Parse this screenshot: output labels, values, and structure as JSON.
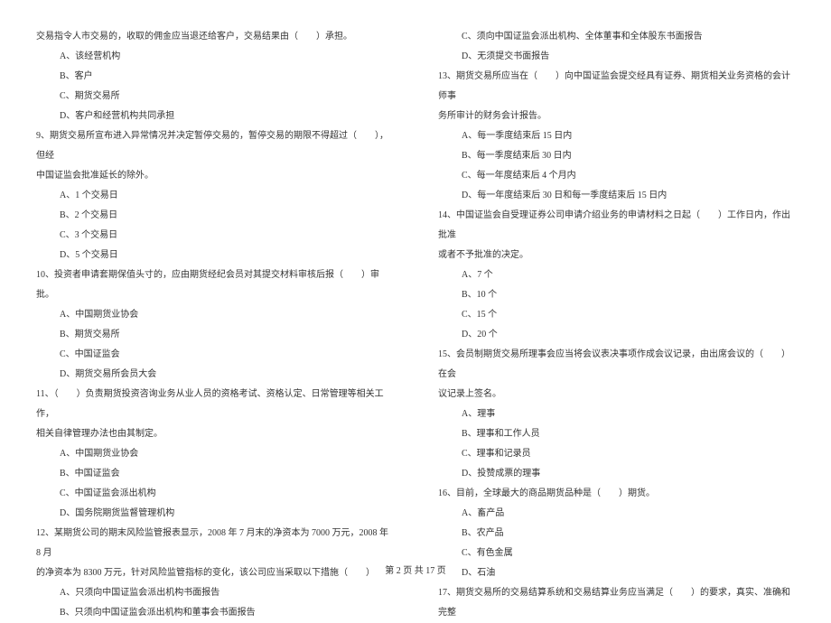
{
  "left_column": [
    {
      "type": "question",
      "text": "交易指令人市交易的，收取的佣金应当退还给客户，交易结果由（　　）承担。"
    },
    {
      "type": "option",
      "text": "A、该经营机构"
    },
    {
      "type": "option",
      "text": "B、客户"
    },
    {
      "type": "option",
      "text": "C、期货交易所"
    },
    {
      "type": "option",
      "text": "D、客户和经营机构共同承担"
    },
    {
      "type": "question",
      "text": "9、期货交易所宣布进入异常情况并决定暂停交易的，暂停交易的期限不得超过（　　），但经"
    },
    {
      "type": "continuation",
      "text": "中国证监会批准延长的除外。"
    },
    {
      "type": "option",
      "text": "A、1 个交易日"
    },
    {
      "type": "option",
      "text": "B、2 个交易日"
    },
    {
      "type": "option",
      "text": "C、3 个交易日"
    },
    {
      "type": "option",
      "text": "D、5 个交易日"
    },
    {
      "type": "question",
      "text": "10、投资者申请套期保值头寸的，应由期货经纪会员对其提交材料审核后报（　　）审批。"
    },
    {
      "type": "option",
      "text": "A、中国期货业协会"
    },
    {
      "type": "option",
      "text": "B、期货交易所"
    },
    {
      "type": "option",
      "text": "C、中国证监会"
    },
    {
      "type": "option",
      "text": "D、期货交易所会员大会"
    },
    {
      "type": "question",
      "text": "11、（　　）负责期货投资咨询业务从业人员的资格考试、资格认定、日常管理等相关工作，"
    },
    {
      "type": "continuation",
      "text": "相关自律管理办法也由其制定。"
    },
    {
      "type": "option",
      "text": "A、中国期货业协会"
    },
    {
      "type": "option",
      "text": "B、中国证监会"
    },
    {
      "type": "option",
      "text": "C、中国证监会派出机构"
    },
    {
      "type": "option",
      "text": "D、国务院期货监督管理机构"
    },
    {
      "type": "question",
      "text": "12、某期货公司的期末风险监管报表显示，2008 年 7 月末的净资本为 7000 万元，2008 年 8 月"
    },
    {
      "type": "continuation",
      "text": "的净资本为 8300 万元，针对风险监管指标的变化，该公司应当采取以下措施（　　）"
    },
    {
      "type": "option",
      "text": "A、只须向中国证监会派出机构书面报告"
    },
    {
      "type": "option",
      "text": "B、只须向中国证监会派出机构和董事会书面报告"
    }
  ],
  "right_column": [
    {
      "type": "option",
      "text": "C、须向中国证监会派出机构、全体董事和全体股东书面报告"
    },
    {
      "type": "option",
      "text": "D、无须提交书面报告"
    },
    {
      "type": "question",
      "text": "13、期货交易所应当在（　　）向中国证监会提交经具有证券、期货相关业务资格的会计师事"
    },
    {
      "type": "continuation",
      "text": "务所审计的财务会计报告。"
    },
    {
      "type": "option",
      "text": "A、每一季度结束后 15 日内"
    },
    {
      "type": "option",
      "text": "B、每一季度结束后 30 日内"
    },
    {
      "type": "option",
      "text": "C、每一年度结束后 4 个月内"
    },
    {
      "type": "option",
      "text": "D、每一年度结束后 30 日和每一季度结束后 15 日内"
    },
    {
      "type": "question",
      "text": "14、中国证监会自受理证券公司申请介绍业务的申请材料之日起（　　）工作日内，作出批准"
    },
    {
      "type": "continuation",
      "text": "或者不予批准的决定。"
    },
    {
      "type": "option",
      "text": "A、7 个"
    },
    {
      "type": "option",
      "text": "B、10 个"
    },
    {
      "type": "option",
      "text": "C、15 个"
    },
    {
      "type": "option",
      "text": "D、20 个"
    },
    {
      "type": "question",
      "text": "15、会员制期货交易所理事会应当将会议表决事项作成会议记录，由出席会议的（　　）在会"
    },
    {
      "type": "continuation",
      "text": "议记录上签名。"
    },
    {
      "type": "option",
      "text": "A、理事"
    },
    {
      "type": "option",
      "text": "B、理事和工作人员"
    },
    {
      "type": "option",
      "text": "C、理事和记录员"
    },
    {
      "type": "option",
      "text": "D、投赞成票的理事"
    },
    {
      "type": "question",
      "text": "16、目前，全球最大的商品期货品种是（　　）期货。"
    },
    {
      "type": "option",
      "text": "A、畜产品"
    },
    {
      "type": "option",
      "text": "B、农产品"
    },
    {
      "type": "option",
      "text": "C、有色金属"
    },
    {
      "type": "option",
      "text": "D、石油"
    },
    {
      "type": "question",
      "text": "17、期货交易所的交易结算系统和交易结算业务应当满足（　　）的要求，真实、准确和完整"
    }
  ],
  "footer": "第 2 页 共 17 页"
}
